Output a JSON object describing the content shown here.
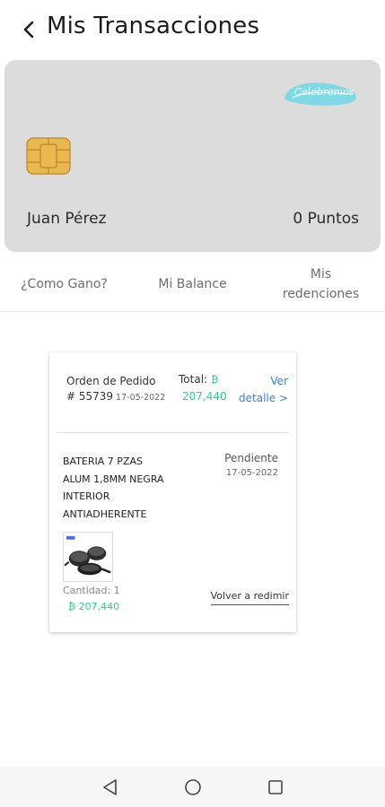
{
  "header": {
    "title": "Mis Transacciones",
    "back_icon": "chevron-left-icon"
  },
  "card": {
    "logo_text": "Celebremos",
    "holder_name": "Juan Pérez",
    "points": "0 Puntos",
    "background_color": "#dcdcdc",
    "chip_color": "#e9b84e"
  },
  "tabs": [
    {
      "label": "¿Como Gano?"
    },
    {
      "label": "Mi Balance"
    },
    {
      "label": "Mis redenciones"
    }
  ],
  "order": {
    "label": "Orden de Pedido",
    "number": "# 55739",
    "date": "17-05-2022",
    "total_label": "Total:",
    "total_value": "207,440",
    "coin_icon": "coin-icon",
    "detail_link": "Ver detalle >",
    "product_name": "BATERIA 7 PZAS ALUM 1,8MM NEGRA INTERIOR ANTIADHERENTE",
    "status": "Pendiente",
    "status_date": "17-05-2022",
    "quantity": "Cantidad: 1",
    "price": "207,440",
    "redeem_button": "Volver a redimir",
    "accent_color": "#2ccf8e",
    "link_color": "#3b7fd9"
  },
  "navbar": {
    "icons": [
      "nav-back-icon",
      "nav-home-icon",
      "nav-recents-icon"
    ]
  }
}
